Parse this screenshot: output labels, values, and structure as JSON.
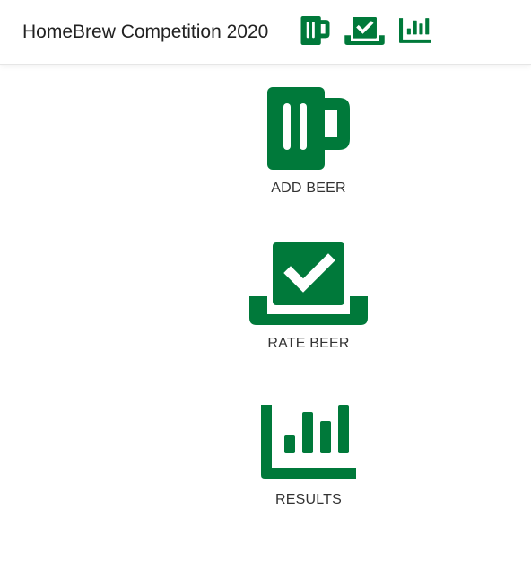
{
  "app": {
    "title": "HomeBrew Competition 2020",
    "accent_color": "#00793a"
  },
  "nav": {
    "icons": [
      {
        "name": "beer-mug-icon",
        "target": "add-beer"
      },
      {
        "name": "ballot-check-icon",
        "target": "rate-beer"
      },
      {
        "name": "bar-chart-icon",
        "target": "results"
      }
    ]
  },
  "menu": {
    "items": [
      {
        "label": "ADD BEER",
        "icon": "beer-mug-icon"
      },
      {
        "label": "RATE BEER",
        "icon": "ballot-check-icon"
      },
      {
        "label": "RESULTS",
        "icon": "bar-chart-icon"
      }
    ]
  }
}
